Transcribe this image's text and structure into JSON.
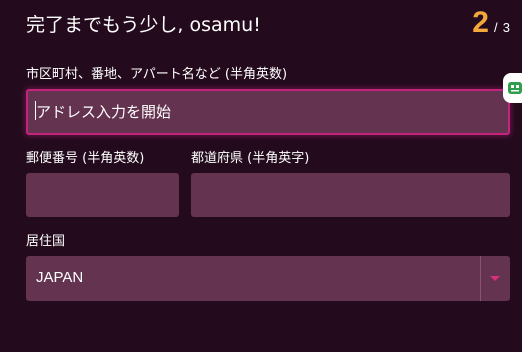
{
  "header": {
    "title": "完了までもう少し, osamu!",
    "step_current": "2",
    "step_separator": "/",
    "step_total": "3"
  },
  "form": {
    "address": {
      "label": "市区町村、番地、アパート名など (半角英数)",
      "placeholder": "アドレス入力を開始",
      "value": ""
    },
    "postal_code": {
      "label": "郵便番号 (半角英数)",
      "value": ""
    },
    "prefecture": {
      "label": "都道府県 (半角英字)",
      "value": ""
    },
    "country": {
      "label": "居住国",
      "selected": "JAPAN"
    }
  },
  "colors": {
    "background": "#230b1d",
    "field": "#64334f",
    "focus_border": "#c4247e",
    "step_accent": "#f2a83a",
    "dropdown_arrow": "#d6307f",
    "side_badge_icon": "#2f9e4d"
  },
  "icons": {
    "side_badge": "password-manager-icon",
    "select_caret": "caret-down-icon"
  }
}
